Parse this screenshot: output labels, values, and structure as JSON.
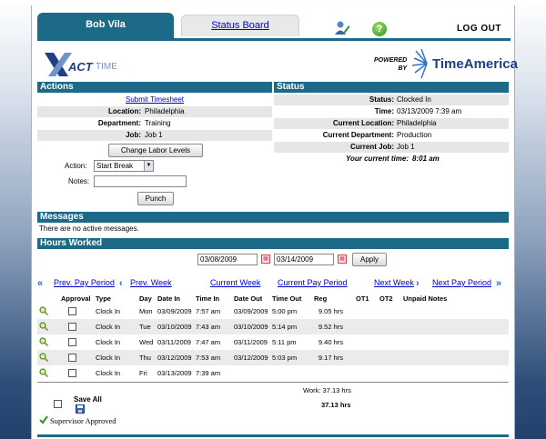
{
  "tabs": {
    "active": "Bob Vila",
    "status_board": "Status Board",
    "logout": "LOG OUT"
  },
  "branding": {
    "powered": "POWERED",
    "by": "BY",
    "time_america": "TimeAmerica",
    "xact": "ACT",
    "time": "TIME",
    "help_glyph": "?"
  },
  "actions": {
    "header": "Actions",
    "submit": "Submit Timesheet",
    "location_label": "Location:",
    "location_value": "Philadelphia",
    "department_label": "Department:",
    "department_value": "Training",
    "job_label": "Job:",
    "job_value": "Job 1",
    "change_labor": "Change Labor Levels",
    "action_label": "Action:",
    "action_value": "Start Break",
    "notes_label": "Notes:",
    "notes_value": "",
    "punch": "Punch"
  },
  "status": {
    "header": "Status",
    "status_label": "Status:",
    "status_value": "Clocked In",
    "time_label": "Time:",
    "time_value": "03/13/2009 7:39 am",
    "cur_loc_label": "Current Location:",
    "cur_loc_value": "Philadelphia",
    "cur_dept_label": "Current Department:",
    "cur_dept_value": "Production",
    "cur_job_label": "Current Job:",
    "cur_job_value": "Job 1",
    "your_time_label": "Your current time:",
    "your_time_value": "8:01 am"
  },
  "messages": {
    "header": "Messages",
    "text": "There are no active messages."
  },
  "hours": {
    "header": "Hours Worked",
    "from": "03/08/2009",
    "to": "03/14/2009",
    "apply": "Apply",
    "nav": {
      "prev_pay": "Prev. Pay Period",
      "prev_week": "Prev. Week",
      "current_week": "Current Week",
      "current_pay": "Current Pay Period",
      "next_week": "Next Week",
      "next_pay": "Next Pay Period"
    },
    "columns": [
      "Approval",
      "Type",
      "Day",
      "Date In",
      "Time In",
      "Date Out",
      "Time Out",
      "Reg",
      "OT1",
      "OT2",
      "Unpaid Notes"
    ],
    "rows": [
      {
        "type": "Clock In",
        "day": "Mon",
        "date_in": "03/09/2009",
        "time_in": "7:57 am",
        "date_out": "03/09/2009",
        "time_out": "5:00 pm",
        "reg": "9.05 hrs"
      },
      {
        "type": "Clock In",
        "day": "Tue",
        "date_in": "03/10/2009",
        "time_in": "7:43 am",
        "date_out": "03/10/2009",
        "time_out": "5:14 pm",
        "reg": "9.52 hrs"
      },
      {
        "type": "Clock In",
        "day": "Wed",
        "date_in": "03/11/2009",
        "time_in": "7:47 am",
        "date_out": "03/11/2009",
        "time_out": "5:11 pm",
        "reg": "9.40 hrs"
      },
      {
        "type": "Clock In",
        "day": "Thu",
        "date_in": "03/12/2009",
        "time_in": "7:53 am",
        "date_out": "03/12/2009",
        "time_out": "5:03 pm",
        "reg": "9.17 hrs"
      },
      {
        "type": "Clock In",
        "day": "Fri",
        "date_in": "03/13/2009",
        "time_in": "7:39 am",
        "date_out": "",
        "time_out": "",
        "reg": ""
      }
    ],
    "work_label": "Work:",
    "work_value": "37.13 hrs",
    "total": "37.13 hrs",
    "save_all": "Save All",
    "supervisor": "Supervisor Approved"
  },
  "colors": {
    "header_bg": "#1c6a87",
    "link": "#0000cc"
  }
}
